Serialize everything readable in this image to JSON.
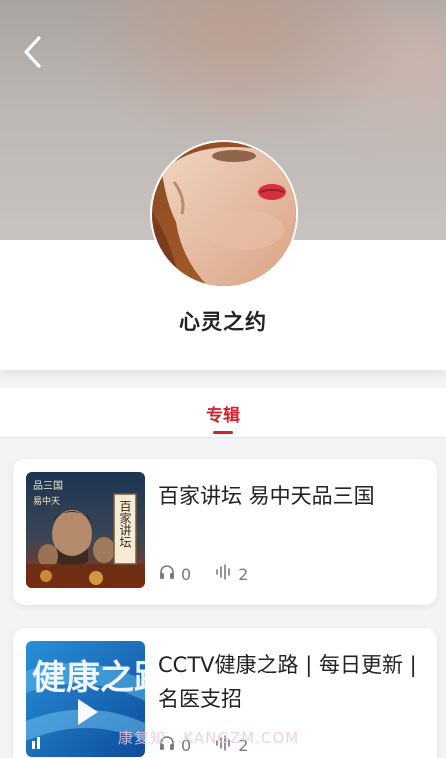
{
  "profile": {
    "name": "心灵之约"
  },
  "tabs": [
    {
      "label": "专辑",
      "active": true
    }
  ],
  "albums": [
    {
      "title": "百家讲坛 易中天品三国",
      "listens": "0",
      "tracks": "2",
      "cover_text": [
        "品三国",
        "易中天",
        "百家讲坛"
      ]
    },
    {
      "title": "CCTV健康之路 | 每日更新 | 名医支招",
      "listens": "0",
      "tracks": "2",
      "cover_text": [
        "健康之路"
      ]
    }
  ],
  "watermark": "康复知...KANGZM.COM",
  "colors": {
    "accent": "#d3232f",
    "background": "#f4f4f4",
    "card": "#ffffff"
  },
  "icons": {
    "back": "chevron-left-icon",
    "listens": "headphones-icon",
    "tracks": "audio-wave-icon"
  }
}
